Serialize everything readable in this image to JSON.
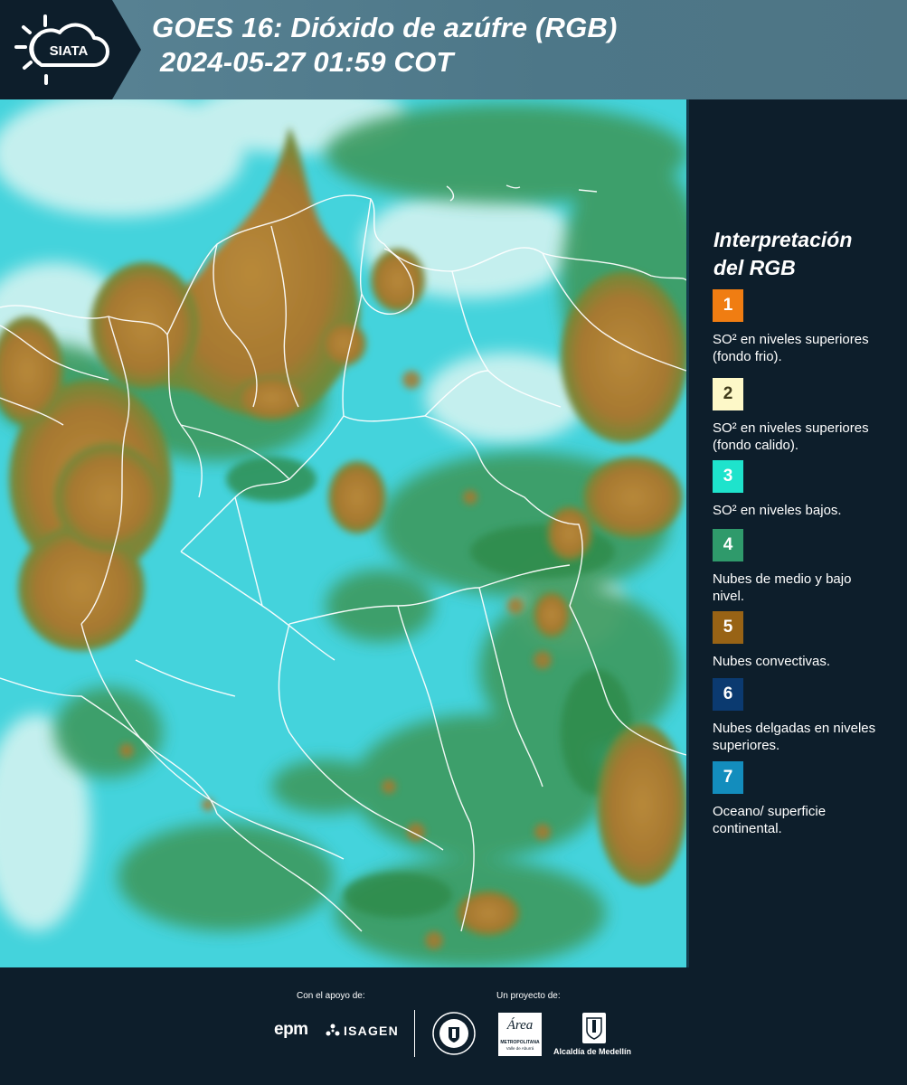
{
  "header": {
    "logo_text": "SIATA",
    "title_line1": "GOES 16: Dióxido de azúfre (RGB)",
    "title_line2": "2024-05-27 01:59 COT"
  },
  "map": {
    "image": "satellite-rgb-sulfur-dioxide-colombia",
    "colors": {
      "background": "#46d4dd",
      "vegetation_green": "#3f9b5c",
      "convective_brown": "#a9792e",
      "thin_cloud_white": "#dff6f4",
      "borders": "#ffffff"
    }
  },
  "legend": {
    "title_line1": "Interpretación",
    "title_line2": "del RGB",
    "items": [
      {
        "number": "1",
        "color": "#f07d12",
        "text": "SO² en niveles superiores (fondo frio)."
      },
      {
        "number": "2",
        "color": "#fdf8c8",
        "text": "SO² en niveles superiores (fondo calido)."
      },
      {
        "number": "3",
        "color": "#1ee3cc",
        "text": "SO² en niveles bajos."
      },
      {
        "number": "4",
        "color": "#2f9a6b",
        "text": "Nubes de medio y bajo nivel."
      },
      {
        "number": "5",
        "color": "#986315",
        "text": "Nubes convectivas."
      },
      {
        "number": "6",
        "color": "#0b3a70",
        "text": "Nubes delgadas en niveles superiores."
      },
      {
        "number": "7",
        "color": "#138dbd",
        "text": "Oceano/ superficie continental."
      }
    ]
  },
  "footer": {
    "support_label": "Con el apoyo de:",
    "project_label": "Un proyecto de:",
    "epm": "epm",
    "isagen": "ISAGEN",
    "area_metropolitana": "Área",
    "area_sub": "METROPOLITANA",
    "area_sub2": "Valle de Aburrá",
    "alcaldia": "Alcaldía de Medellín"
  }
}
